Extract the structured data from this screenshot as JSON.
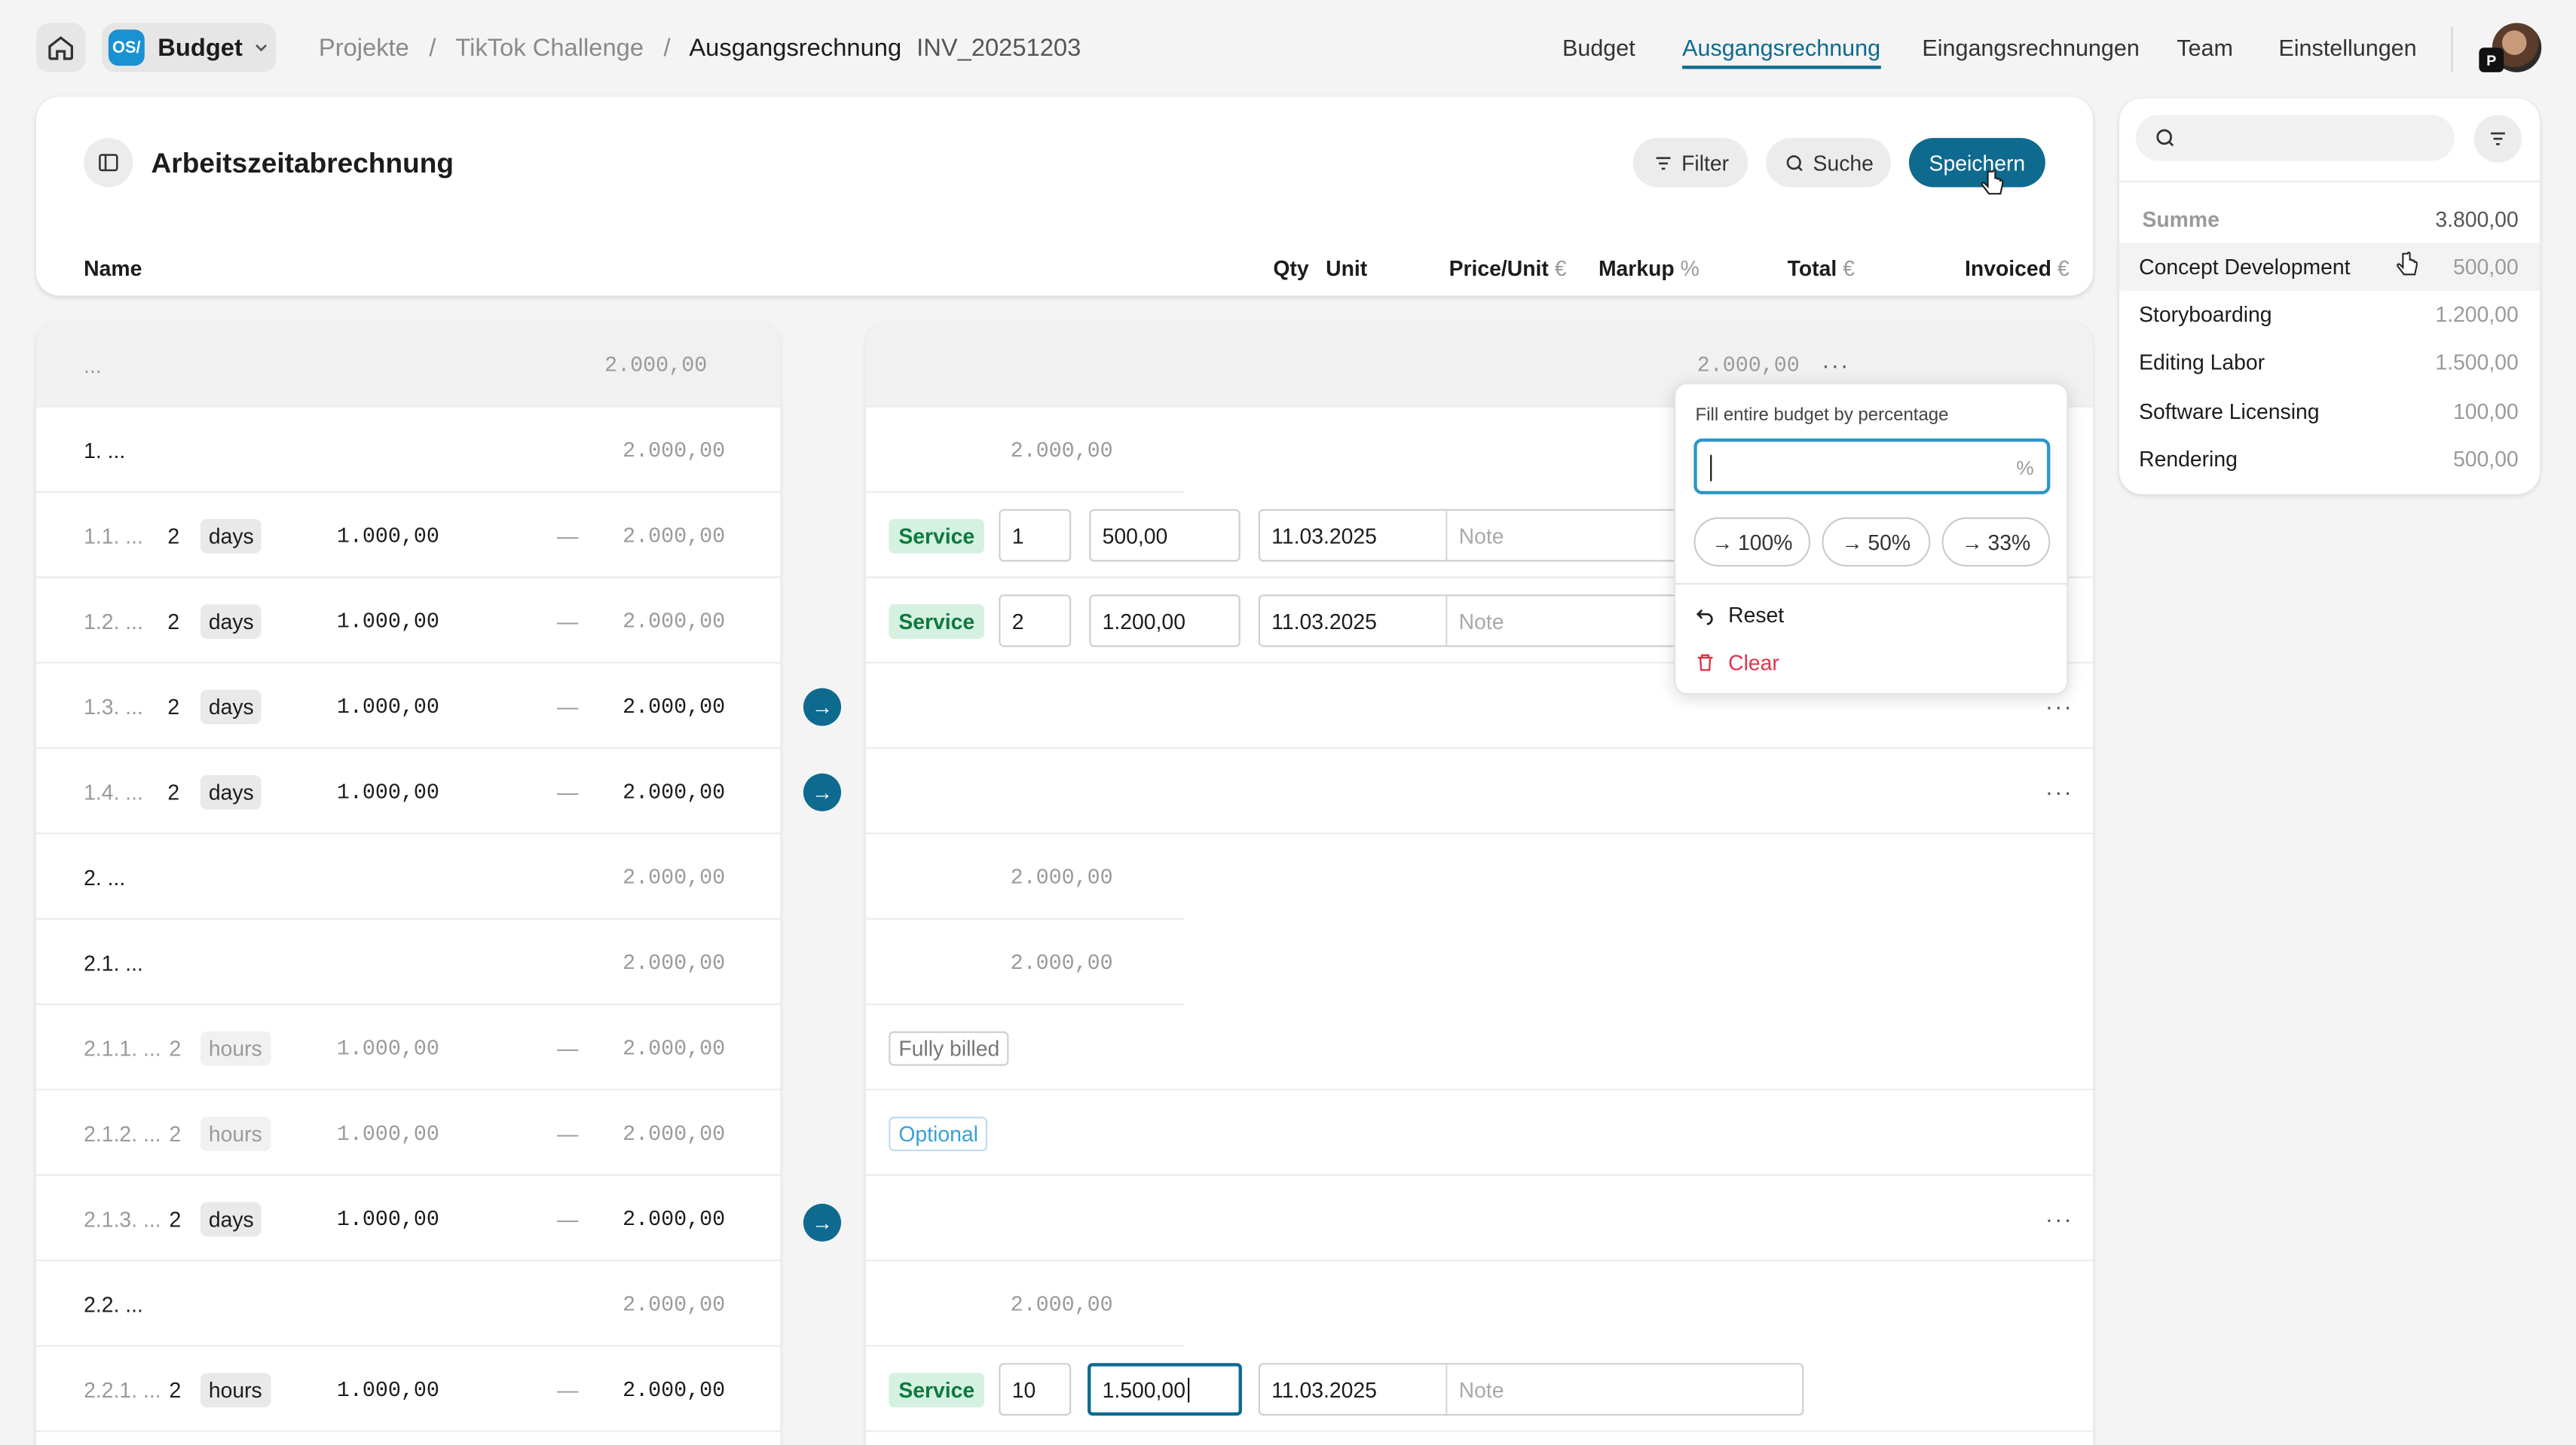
{
  "topbar": {
    "app_logo": "OS/",
    "budget_label": "Budget",
    "breadcrumb": [
      "Projekte",
      "/",
      "TikTok Challenge",
      "/",
      "Ausgangsrechnung"
    ],
    "invoice_id": "INV_20251203",
    "nav": [
      "Budget",
      "Ausgangsrechnung",
      "Eingangsrechnungen",
      "Team",
      "Einstellungen"
    ],
    "active_nav": "Ausgangsrechnung",
    "avatar_badge": "P"
  },
  "header": {
    "title": "Arbeitszeitabrechnung",
    "filter_label": "Filter",
    "search_label": "Suche",
    "save_label": "Speichern",
    "columns": {
      "name": "Name",
      "qty": "Qty",
      "unit": "Unit",
      "price": "Price/Unit",
      "price_cur": "€",
      "markup": "Markup",
      "markup_pct": "%",
      "total": "Total",
      "total_cur": "€",
      "invoiced": "Invoiced",
      "invoiced_cur": "€"
    }
  },
  "rows": [
    {
      "kind": "header",
      "label": "...",
      "total": "2.000,00",
      "right_total": "2.000,00"
    },
    {
      "kind": "group",
      "label": "1. ...",
      "total": "2.000,00",
      "right_total": "2.000,00"
    },
    {
      "kind": "item",
      "label": "1.1. ...",
      "qty": "2",
      "unit": "days",
      "price": "1.000,00",
      "markup": "—",
      "total": "2.000,00",
      "tag": "Service",
      "inv_qty": "1",
      "inv_price": "500,00",
      "date": "11.03.2025",
      "note": "Note"
    },
    {
      "kind": "item",
      "label": "1.2. ...",
      "qty": "2",
      "unit": "days",
      "price": "1.000,00",
      "markup": "—",
      "total": "2.000,00",
      "tag": "Service",
      "inv_qty": "2",
      "inv_price": "1.200,00",
      "date": "11.03.2025",
      "note": "Note"
    },
    {
      "kind": "item",
      "label": "1.3. ...",
      "qty": "2",
      "unit": "days",
      "price": "1.000,00",
      "markup": "—",
      "total": "2.000,00"
    },
    {
      "kind": "item",
      "label": "1.4. ...",
      "qty": "2",
      "unit": "days",
      "price": "1.000,00",
      "markup": "—",
      "total": "2.000,00"
    },
    {
      "kind": "group",
      "label": "2. ...",
      "total": "2.000,00",
      "right_total": "2.000,00"
    },
    {
      "kind": "group",
      "label": "2.1. ...",
      "total": "2.000,00",
      "right_total": "2.000,00"
    },
    {
      "kind": "item",
      "label": "2.1.1. ...",
      "qty": "2",
      "unit": "hours",
      "price": "1.000,00",
      "markup": "—",
      "total": "2.000,00",
      "status": "Fully billed"
    },
    {
      "kind": "item",
      "label": "2.1.2. ...",
      "qty": "2",
      "unit": "hours",
      "price": "1.000,00",
      "markup": "—",
      "total": "2.000,00",
      "status": "Optional"
    },
    {
      "kind": "item",
      "label": "2.1.3. ...",
      "qty": "2",
      "unit": "days",
      "price": "1.000,00",
      "markup": "—",
      "total": "2.000,00"
    },
    {
      "kind": "group",
      "label": "2.2. ...",
      "total": "2.000,00",
      "right_total": "2.000,00"
    },
    {
      "kind": "item",
      "label": "2.2.1. ...",
      "qty": "2",
      "unit": "hours",
      "price": "1.000,00",
      "markup": "—",
      "total": "2.000,00",
      "tag": "Service",
      "inv_qty": "10",
      "inv_price": "1.500,00",
      "date": "11.03.2025",
      "note": "Note"
    }
  ],
  "popover": {
    "title": "Fill entire budget by percentage",
    "percent_sign": "%",
    "chips": [
      "100%",
      "50%",
      "33%"
    ],
    "reset_label": "Reset",
    "clear_label": "Clear"
  },
  "summary": {
    "total_label": "Summe",
    "total_value": "3.800,00",
    "items": [
      {
        "label": "Concept Development",
        "value": "500,00"
      },
      {
        "label": "Storyboarding",
        "value": "1.200,00"
      },
      {
        "label": "Editing Labor",
        "value": "1.500,00"
      },
      {
        "label": "Software Licensing",
        "value": "100,00"
      },
      {
        "label": "Rendering",
        "value": "500,00"
      }
    ]
  },
  "colors": {
    "accent": "#0e6a8f",
    "service_bg": "#d5f1e2",
    "service_fg": "#0e7a3d",
    "danger": "#e0334a"
  }
}
